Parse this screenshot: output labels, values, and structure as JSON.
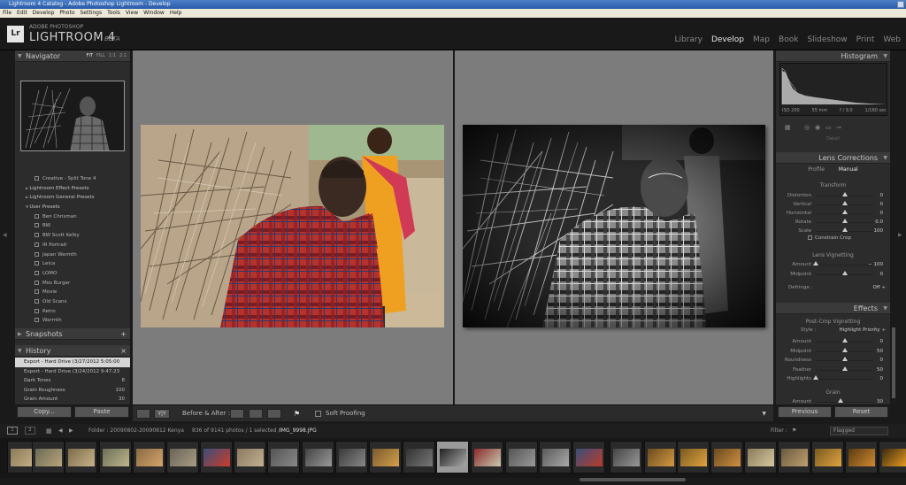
{
  "window": {
    "title": "Lightroom 4 Catalog - Adobe Photoshop Lightroom - Develop"
  },
  "menu": [
    "File",
    "Edit",
    "Develop",
    "Photo",
    "Settings",
    "Tools",
    "View",
    "Window",
    "Help"
  ],
  "identity": {
    "logo": "Lr",
    "brand_top": "ADOBE PHOTOSHOP",
    "brand_main": "LIGHTROOM 4",
    "brand_tag": "BETA"
  },
  "modules": [
    {
      "label": "Library",
      "active": false
    },
    {
      "label": "Develop",
      "active": true
    },
    {
      "label": "Map",
      "active": false
    },
    {
      "label": "Book",
      "active": false
    },
    {
      "label": "Slideshow",
      "active": false
    },
    {
      "label": "Print",
      "active": false
    },
    {
      "label": "Web",
      "active": false
    }
  ],
  "navigator": {
    "title": "Navigator",
    "zoom": [
      "FIT",
      "FILL",
      "1:1",
      "2:1"
    ]
  },
  "presets": {
    "items": [
      {
        "label": "Creative - Split Tone 4",
        "kind": "preset"
      },
      {
        "label": "Lightroom Effect Presets",
        "kind": "folder"
      },
      {
        "label": "Lightroom General Presets",
        "kind": "folder"
      },
      {
        "label": "User Presets",
        "kind": "folder-open"
      },
      {
        "label": "Ben Chrisman",
        "kind": "preset"
      },
      {
        "label": "BW",
        "kind": "preset"
      },
      {
        "label": "BW Scott Kelby",
        "kind": "preset"
      },
      {
        "label": "IR Portrait",
        "kind": "preset"
      },
      {
        "label": "Japan Warmth",
        "kind": "preset"
      },
      {
        "label": "Leica",
        "kind": "preset"
      },
      {
        "label": "LOMO",
        "kind": "preset"
      },
      {
        "label": "Mos Burger",
        "kind": "preset"
      },
      {
        "label": "Movie",
        "kind": "preset"
      },
      {
        "label": "Old Scans",
        "kind": "preset"
      },
      {
        "label": "Retro",
        "kind": "preset"
      },
      {
        "label": "Warmth",
        "kind": "preset"
      }
    ]
  },
  "snapshots": {
    "title": "Snapshots",
    "add": "+"
  },
  "history": {
    "title": "History",
    "close": "×",
    "items": [
      {
        "label": "Export - Hard Drive (3/27/2012 5:05:00 ...",
        "v1": "",
        "v2": "",
        "selected": true
      },
      {
        "label": "Export - Hard Drive (3/24/2012 9:47:23 ...",
        "v1": "",
        "v2": "",
        "selected": false
      },
      {
        "label": "Dark Tones",
        "v1": "",
        "v2": "8",
        "selected": false
      },
      {
        "label": "Grain Roughness",
        "v1": "",
        "v2": "100",
        "selected": false
      },
      {
        "label": "Grain Amount",
        "v1": "",
        "v2": "30",
        "selected": false
      }
    ]
  },
  "left_buttons": {
    "copy": "Copy...",
    "paste": "Paste"
  },
  "toolbar": {
    "before_after": "Before & After :",
    "soft_proofing": "Soft Proofing",
    "yy": "Y|Y"
  },
  "histogram": {
    "title": "Histogram",
    "iso": "ISO 200",
    "focal": "55 mm",
    "aperture": "f / 9.0",
    "shutter": "1/160 sec"
  },
  "detail_label": "Detail",
  "lens": {
    "title": "Lens Corrections",
    "tabs": [
      "Profile",
      "Manual"
    ],
    "transform_title": "Transform",
    "sliders": [
      {
        "label": "Distortion",
        "value": "0",
        "pos": 0.5
      },
      {
        "label": "Vertical",
        "value": "0",
        "pos": 0.5
      },
      {
        "label": "Horizontal",
        "value": "0",
        "pos": 0.5
      },
      {
        "label": "Rotate",
        "value": "0.0",
        "pos": 0.5
      },
      {
        "label": "Scale",
        "value": "100",
        "pos": 0.5
      }
    ],
    "constrain": "Constrain Crop",
    "vignette_title": "Lens Vignetting",
    "vignette": [
      {
        "label": "Amount",
        "value": "− 100",
        "pos": 0.0
      },
      {
        "label": "Midpoint",
        "value": "0",
        "pos": 0.5
      }
    ],
    "defringe_label": "Defringe :",
    "defringe_value": "Off ÷"
  },
  "effects": {
    "title": "Effects",
    "pcv_title": "Post-Crop Vignetting",
    "style_label": "Style :",
    "style_value": "Highlight Priority ÷",
    "sliders": [
      {
        "label": "Amount",
        "value": "0",
        "pos": 0.5
      },
      {
        "label": "Midpoint",
        "value": "50",
        "pos": 0.5
      },
      {
        "label": "Roundness",
        "value": "0",
        "pos": 0.5
      },
      {
        "label": "Feather",
        "value": "50",
        "pos": 0.5
      },
      {
        "label": "Highlights",
        "value": "0",
        "pos": 0.0
      }
    ],
    "grain_title": "Grain",
    "grain_first": "Amount",
    "grain_first_value": "30"
  },
  "right_buttons": {
    "previous": "Previous",
    "reset": "Reset"
  },
  "filmbar": {
    "pages": [
      "1",
      "2"
    ],
    "folder": "Folder : 20090802-20090812 Kenya",
    "count": "836 of 9141 photos / 1 selected /",
    "file": "IMG_9998.JPG",
    "filter_label": "Filter :",
    "filter_value": "Flagged"
  },
  "thumbs": [
    {
      "c1": "#8a7a5a",
      "c2": "#c9b48a"
    },
    {
      "c1": "#6b6a55",
      "c2": "#b8a57a"
    },
    {
      "c1": "#7c6c48",
      "c2": "#c7b38a"
    },
    {
      "c1": "#6b6f56",
      "c2": "#bfb68e"
    },
    {
      "c1": "#8a6a44",
      "c2": "#d5a46a"
    },
    {
      "c1": "#6a6458",
      "c2": "#a89c84"
    },
    {
      "c1": "#3a4f7a",
      "c2": "#cc3b2b"
    },
    {
      "c1": "#8a7a60",
      "c2": "#c2b090"
    },
    {
      "c1": "#555",
      "c2": "#888"
    },
    {
      "c1": "#444",
      "c2": "#999"
    },
    {
      "c1": "#3a3a3a",
      "c2": "#888"
    },
    {
      "c1": "#7a5a30",
      "c2": "#d4a04a"
    },
    {
      "c1": "#333",
      "c2": "#777"
    },
    {
      "c1": "#222",
      "c2": "#aaa"
    },
    {
      "c1": "#8b2a2a",
      "c2": "#c9c9b0"
    },
    {
      "c1": "#555",
      "c2": "#999"
    },
    {
      "c1": "#5a5a5a",
      "c2": "#aaa"
    },
    {
      "c1": "#3a4f7a",
      "c2": "#bb3b2b"
    },
    {
      "c1": "#444",
      "c2": "#999"
    },
    {
      "c1": "#6a4a20",
      "c2": "#d49a40"
    },
    {
      "c1": "#7a5a20",
      "c2": "#e0a440"
    },
    {
      "c1": "#6a4a20",
      "c2": "#d09040"
    },
    {
      "c1": "#8a7a5a",
      "c2": "#d5c8a0"
    },
    {
      "c1": "#6a5a40",
      "c2": "#c0a070"
    },
    {
      "c1": "#7a5a20",
      "c2": "#e0a440"
    },
    {
      "c1": "#5a3a10",
      "c2": "#d08a30"
    },
    {
      "c1": "#3a2a10",
      "c2": "#f0a020"
    }
  ],
  "colors": {
    "accent": "#e8e8e8",
    "panel": "#2c2c2c",
    "canvas": "#7c7c7c"
  }
}
